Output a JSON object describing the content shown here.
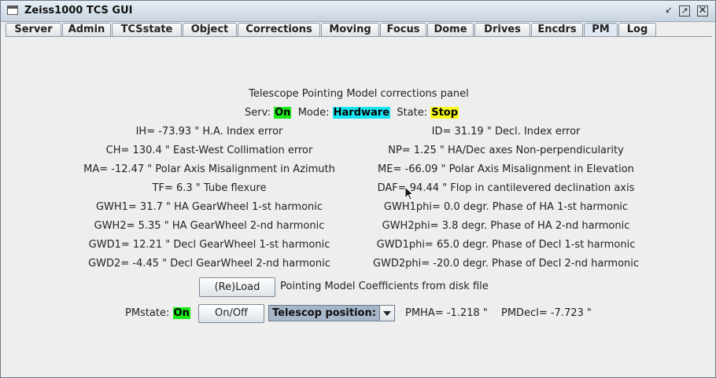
{
  "window": {
    "title": "Zeiss1000 TCS GUI"
  },
  "tabs": [
    "Server",
    "Admin",
    "TCSstate",
    "Object",
    "Corrections",
    "Moving",
    "Focus",
    "Dome",
    "Drives",
    "Encdrs",
    "PM",
    "Log"
  ],
  "active_tab": "PM",
  "panel": {
    "heading": "Telescope Pointing Model corrections panel",
    "status": {
      "serv_label": "Serv:",
      "serv_value": "On",
      "mode_label": "Mode:",
      "mode_value": "Hardware",
      "state_label": "State:",
      "state_value": "Stop"
    },
    "left_params": [
      "IH= -73.93 \" H.A. Index error",
      "CH= 130.4 \" East-West Collimation error",
      "MA= -12.47 \" Polar Axis Misalignment in Azimuth",
      "TF= 6.3 \" Tube flexure",
      "GWH1= 31.7 \" HA GearWheel 1-st harmonic",
      "GWH2= 5.35 \" HA GearWheel 2-nd harmonic",
      "GWD1= 12.21 \" Decl GearWheel 1-st harmonic",
      "GWD2= -4.45 \" Decl GearWheel 2-nd harmonic"
    ],
    "right_params": [
      "ID= 31.19 \" Decl. Index error",
      "NP= 1.25 \" HA/Dec axes Non-perpendicularity",
      "ME= -66.09 \" Polar Axis Misalignment in Elevation",
      "DAF= 94.44 \" Flop in cantilevered declination axis",
      "GWH1phi= 0.0 degr. Phase of HA 1-st harmonic",
      "GWH2phi= 3.8 degr. Phase of HA 2-nd harmonic",
      "GWD1phi= 65.0 degr. Phase of Decl 1-st harmonic",
      "GWD2phi= -20.0 degr. Phase of Decl 2-nd harmonic"
    ],
    "reload_button": "(Re)Load",
    "reload_text": "Pointing Model Coefficients from disk file",
    "pmstate_label": "PMstate:",
    "pmstate_value": "On",
    "onoff_button": "On/Off",
    "position_combo": "Telescop position:",
    "pmha": "PMHA= -1.218 \"",
    "pmdecl": "PMDecl= -7.723 \""
  },
  "colors": {
    "on": "#19e919",
    "hardware": "#17e5f2",
    "stop": "#f7f719"
  }
}
